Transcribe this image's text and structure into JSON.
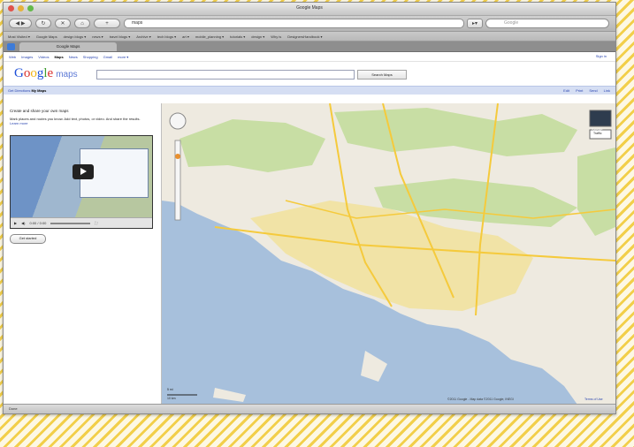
{
  "window": {
    "title": "Google Maps"
  },
  "toolbar": {
    "url": "maps",
    "search_placeholder": "Google"
  },
  "bookmarks": [
    "Most Visited ▾",
    "Google Maps",
    "design blogs ▾",
    "news ▾",
    "travel blogs ▾",
    "Archive ▾",
    "tech blogs ▾",
    "art ▾",
    "mobile_planning ▾",
    "tutorials ▾",
    "design ▾",
    "Why is",
    "DesignersHandbook ▾"
  ],
  "tab": {
    "label": "Google Maps"
  },
  "gbar": {
    "items": [
      "Web",
      "Images",
      "Videos",
      "Maps",
      "News",
      "Shopping",
      "Gmail",
      "more ▾"
    ],
    "active": "Maps",
    "signin": "Sign in"
  },
  "logo": {
    "word": "Google",
    "product": "maps"
  },
  "search": {
    "button": "Search Maps"
  },
  "linkbar": {
    "left_link": "Get Directions",
    "left_active": "My Maps",
    "right": [
      "Edit",
      "Print",
      "Send",
      "Link"
    ]
  },
  "sidebar": {
    "heading": "Create and share your own maps",
    "body": "Mark places and routes you know. Add text, photos, or video. And share the results.",
    "learn_more": "Learn more",
    "video_time": "0:00 / 0:00",
    "get_started": "Get started"
  },
  "map": {
    "buttons": [
      "Satellite",
      "Traffic"
    ],
    "copyright": "©2011 Google - Map data ©2011 Google, INEGI",
    "terms": "Terms of Use",
    "scale_labels": [
      "5 mi",
      "10 km"
    ],
    "colors": {
      "water": "#a7c0dc",
      "land": "#eeeae0",
      "park": "#c8dea4",
      "urban": "#f1e3a6",
      "freeway": "#f5ca3c"
    }
  },
  "status": {
    "text": "Done"
  }
}
